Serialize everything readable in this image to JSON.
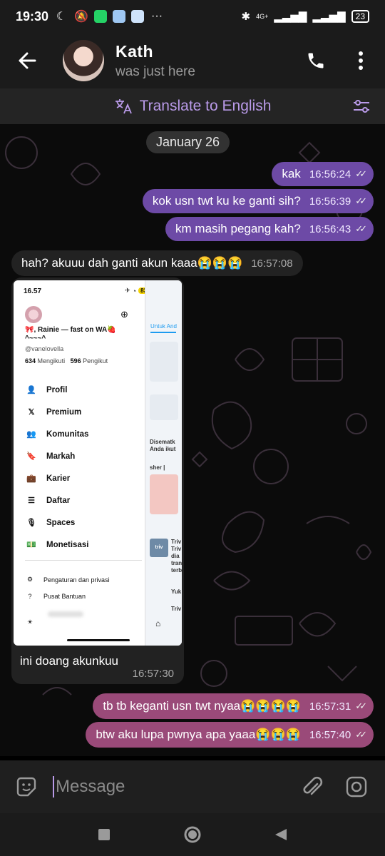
{
  "status_bar": {
    "time": "19:30",
    "network": "4G+",
    "battery": "23"
  },
  "header": {
    "contact_name": "Kath",
    "contact_status": "was just here"
  },
  "translate_bar": {
    "label": "Translate to English"
  },
  "chat": {
    "date_chip": "January 26",
    "messages": [
      {
        "text": "kak",
        "time": "16:56:24",
        "direction": "outgoing"
      },
      {
        "text": "kok usn twt ku ke ganti sih?",
        "time": "16:56:39",
        "direction": "outgoing"
      },
      {
        "text": "km masih pegang kah?",
        "time": "16:56:43",
        "direction": "outgoing"
      },
      {
        "text": "hah? akuuu dah ganti akun kaaa😭😭😭",
        "time": "16:57:08",
        "direction": "incoming"
      },
      {
        "text": "ini doang akunkuu",
        "time": "16:57:30",
        "direction": "incoming"
      },
      {
        "text": "tb tb keganti usn twt nyaa😭😭😭😭",
        "time": "16:57:31",
        "direction": "outgoing"
      },
      {
        "text": "btw aku lupa pwnya apa yaaa😭😭😭",
        "time": "16:57:40",
        "direction": "outgoing"
      }
    ],
    "screenshot": {
      "time": "16.57",
      "battery": "83",
      "display_name": "🎀, Rainie — fast on WA🍓 ^~~~^",
      "handle": "@vanelovella",
      "following_count": "634",
      "following_label": "Mengikuti",
      "followers_count": "596",
      "followers_label": "Pengikut",
      "menu": [
        "Profil",
        "Premium",
        "Komunitas",
        "Markah",
        "Karier",
        "Daftar",
        "Spaces",
        "Monetisasi"
      ],
      "settings_label": "Pengaturan dan privasi",
      "help_label": "Pusat Bantuan",
      "feed_tab": "Untuk And",
      "feed_text_1": "Disematk Anda ikut",
      "feed_text_2": "sher |",
      "feed_text_3": "Triv Triv dia tran terb",
      "feed_text_4": "Yuk",
      "feed_text_5": "Triv",
      "feed_badge": "triv"
    }
  },
  "input": {
    "placeholder": "Message"
  },
  "colors": {
    "accent": "#b99ae8",
    "bubble_purple": "#6d4aa6",
    "bubble_pink": "#9a4a79",
    "incoming": "#222222"
  }
}
